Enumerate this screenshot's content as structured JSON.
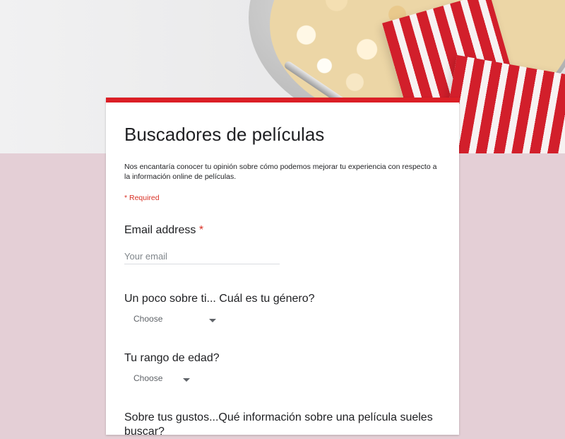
{
  "form": {
    "title": "Buscadores de películas",
    "description": "Nos encantaría conocer tu opinión sobre cómo podemos mejorar tu experiencia con respecto a la información online de películas.",
    "required_note": "* Required",
    "accent_color": "#db1f26",
    "questions": [
      {
        "label": "Email address",
        "required_marker": "*",
        "input_placeholder": "Your email",
        "input_value": ""
      },
      {
        "label": "Un poco sobre ti... Cuál es tu género?",
        "dropdown_value": "Choose"
      },
      {
        "label": "Tu rango de edad?",
        "dropdown_value": "Choose"
      },
      {
        "label": "Sobre tus gustos...Qué información sobre una película sueles buscar?"
      }
    ]
  },
  "header_image": {
    "subject": "popcorn-bowl",
    "colors": {
      "popcorn": "#ecd6a6",
      "box_red": "#d21f2b",
      "box_white": "#f7f2f2"
    }
  },
  "theme": {
    "page_background": "#e4cfd6",
    "card_background": "#ffffff",
    "required_color": "#d93025"
  },
  "icons": {
    "dropdown_arrow": "arrow-drop-down-icon"
  }
}
